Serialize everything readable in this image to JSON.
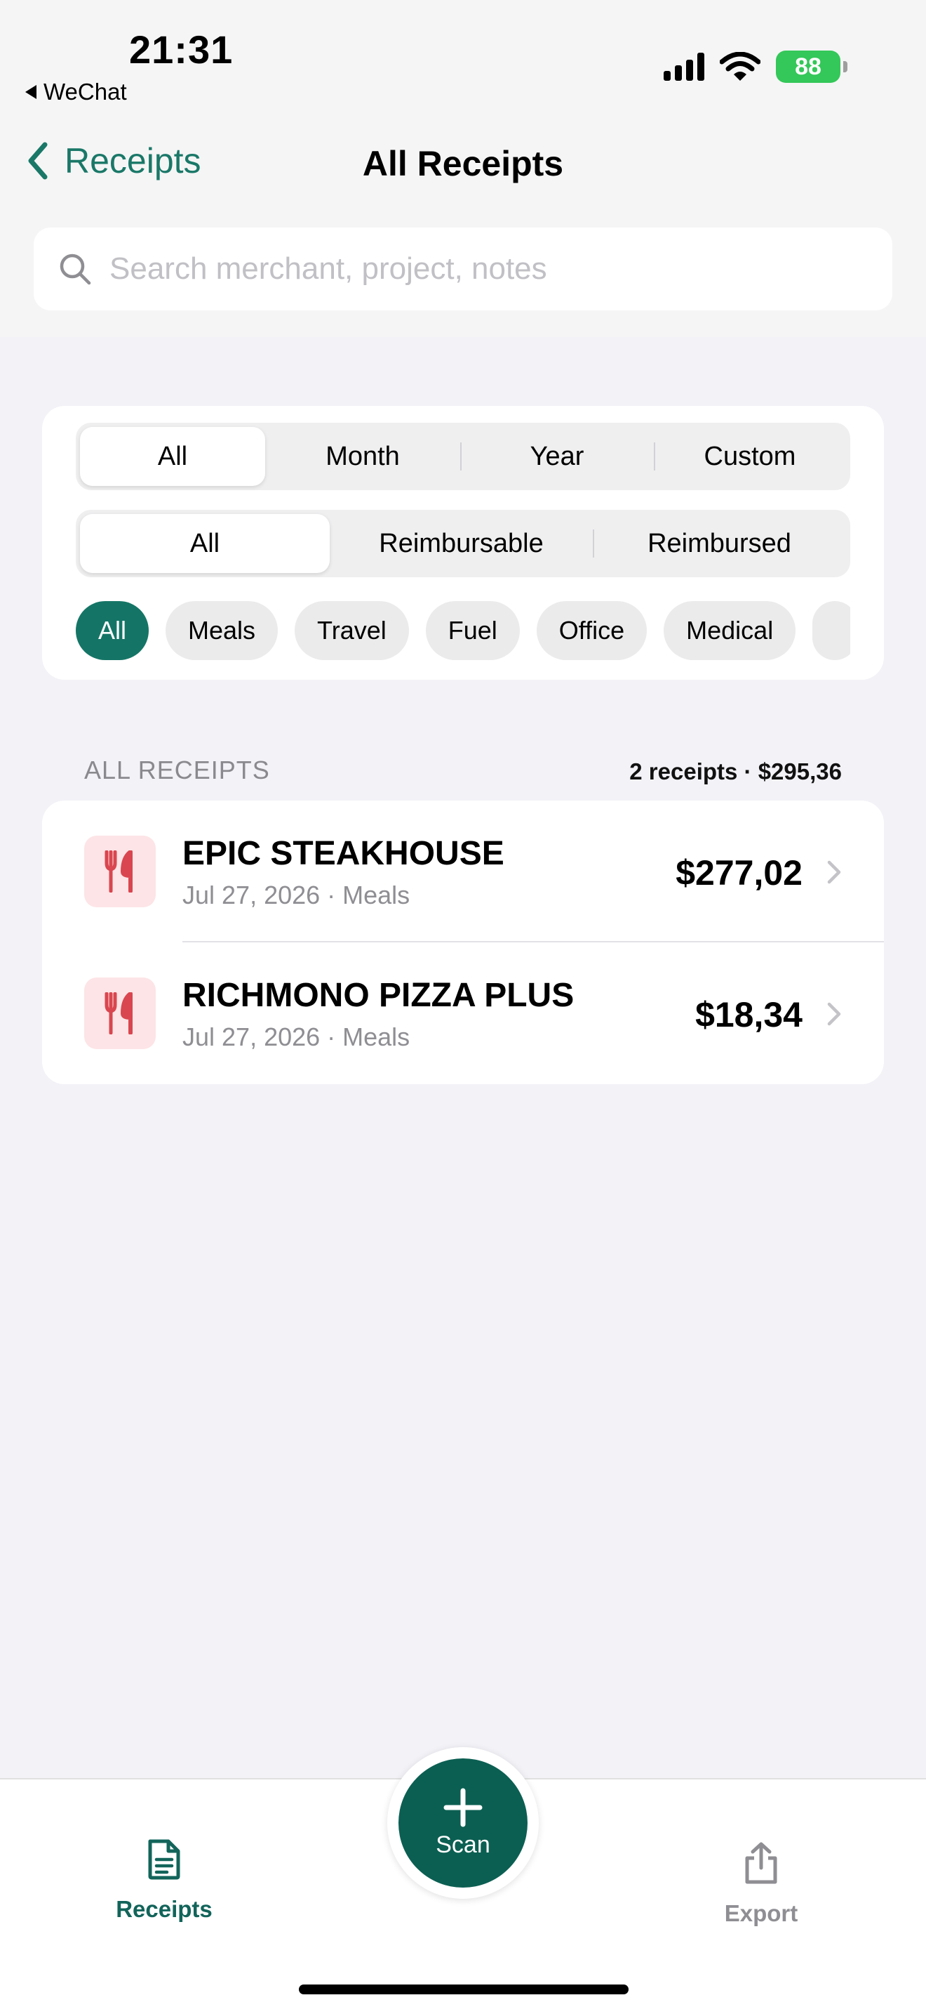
{
  "status_bar": {
    "time": "21:31",
    "back_app": "WeChat",
    "battery": "88"
  },
  "nav": {
    "back_label": "Receipts",
    "title": "All Receipts"
  },
  "search": {
    "placeholder": "Search merchant, project, notes",
    "value": ""
  },
  "filters": {
    "period": [
      {
        "label": "All",
        "active": true
      },
      {
        "label": "Month",
        "active": false
      },
      {
        "label": "Year",
        "active": false
      },
      {
        "label": "Custom",
        "active": false
      }
    ],
    "status": [
      {
        "label": "All",
        "active": true
      },
      {
        "label": "Reimbursable",
        "active": false
      },
      {
        "label": "Reimbursed",
        "active": false
      }
    ],
    "categories": [
      {
        "label": "All",
        "active": true
      },
      {
        "label": "Meals",
        "active": false
      },
      {
        "label": "Travel",
        "active": false
      },
      {
        "label": "Fuel",
        "active": false
      },
      {
        "label": "Office",
        "active": false
      },
      {
        "label": "Medical",
        "active": false
      },
      {
        "label": "",
        "active": false
      }
    ]
  },
  "section": {
    "title": "ALL RECEIPTS",
    "summary": "2 receipts · $295,36"
  },
  "receipts": [
    {
      "merchant": "EPIC STEAKHOUSE",
      "meta": "Jul 27, 2026 · Meals",
      "amount": "$277,02",
      "icon": "fork-knife-icon"
    },
    {
      "merchant": "RICHMONO PIZZA PLUS",
      "meta": "Jul 27, 2026 · Meals",
      "amount": "$18,34",
      "icon": "fork-knife-icon"
    }
  ],
  "tabbar": {
    "receipts_label": "Receipts",
    "scan_label": "Scan",
    "export_label": "Export"
  },
  "colors": {
    "accent": "#147566",
    "accent_dark": "#0b5f52",
    "meals_icon": "#d9464f",
    "meals_bg": "#fde4e6"
  }
}
